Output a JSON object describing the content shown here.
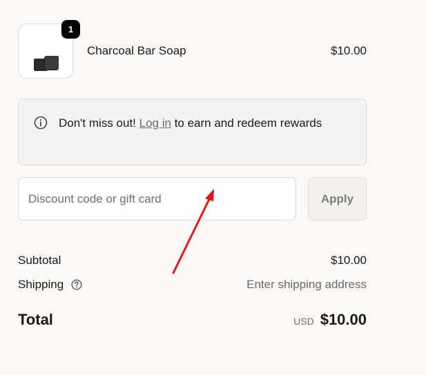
{
  "cart": {
    "item": {
      "name": "Charcoal Bar Soap",
      "price": "$10.00",
      "quantity_badge": "1",
      "image_icon": "soap-product-image"
    }
  },
  "rewards": {
    "prefix": "Don't miss out!",
    "link": "Log in",
    "suffix": "to earn and redeem rewards",
    "icon": "info-icon"
  },
  "discount": {
    "placeholder": "Discount code or gift card",
    "value": "",
    "apply_label": "Apply"
  },
  "summary": {
    "subtotal_label": "Subtotal",
    "subtotal_value": "$10.00",
    "shipping_label": "Shipping",
    "shipping_value": "Enter shipping address",
    "shipping_help_icon": "question-circle-icon",
    "total_label": "Total",
    "currency": "USD",
    "total_value": "$10.00"
  },
  "colors": {
    "background": "#faf9f7",
    "annotation_arrow": "#e0191b",
    "muted_text": "#6b6b6b"
  },
  "annotation": {
    "icon": "red-arrow-annotation"
  }
}
